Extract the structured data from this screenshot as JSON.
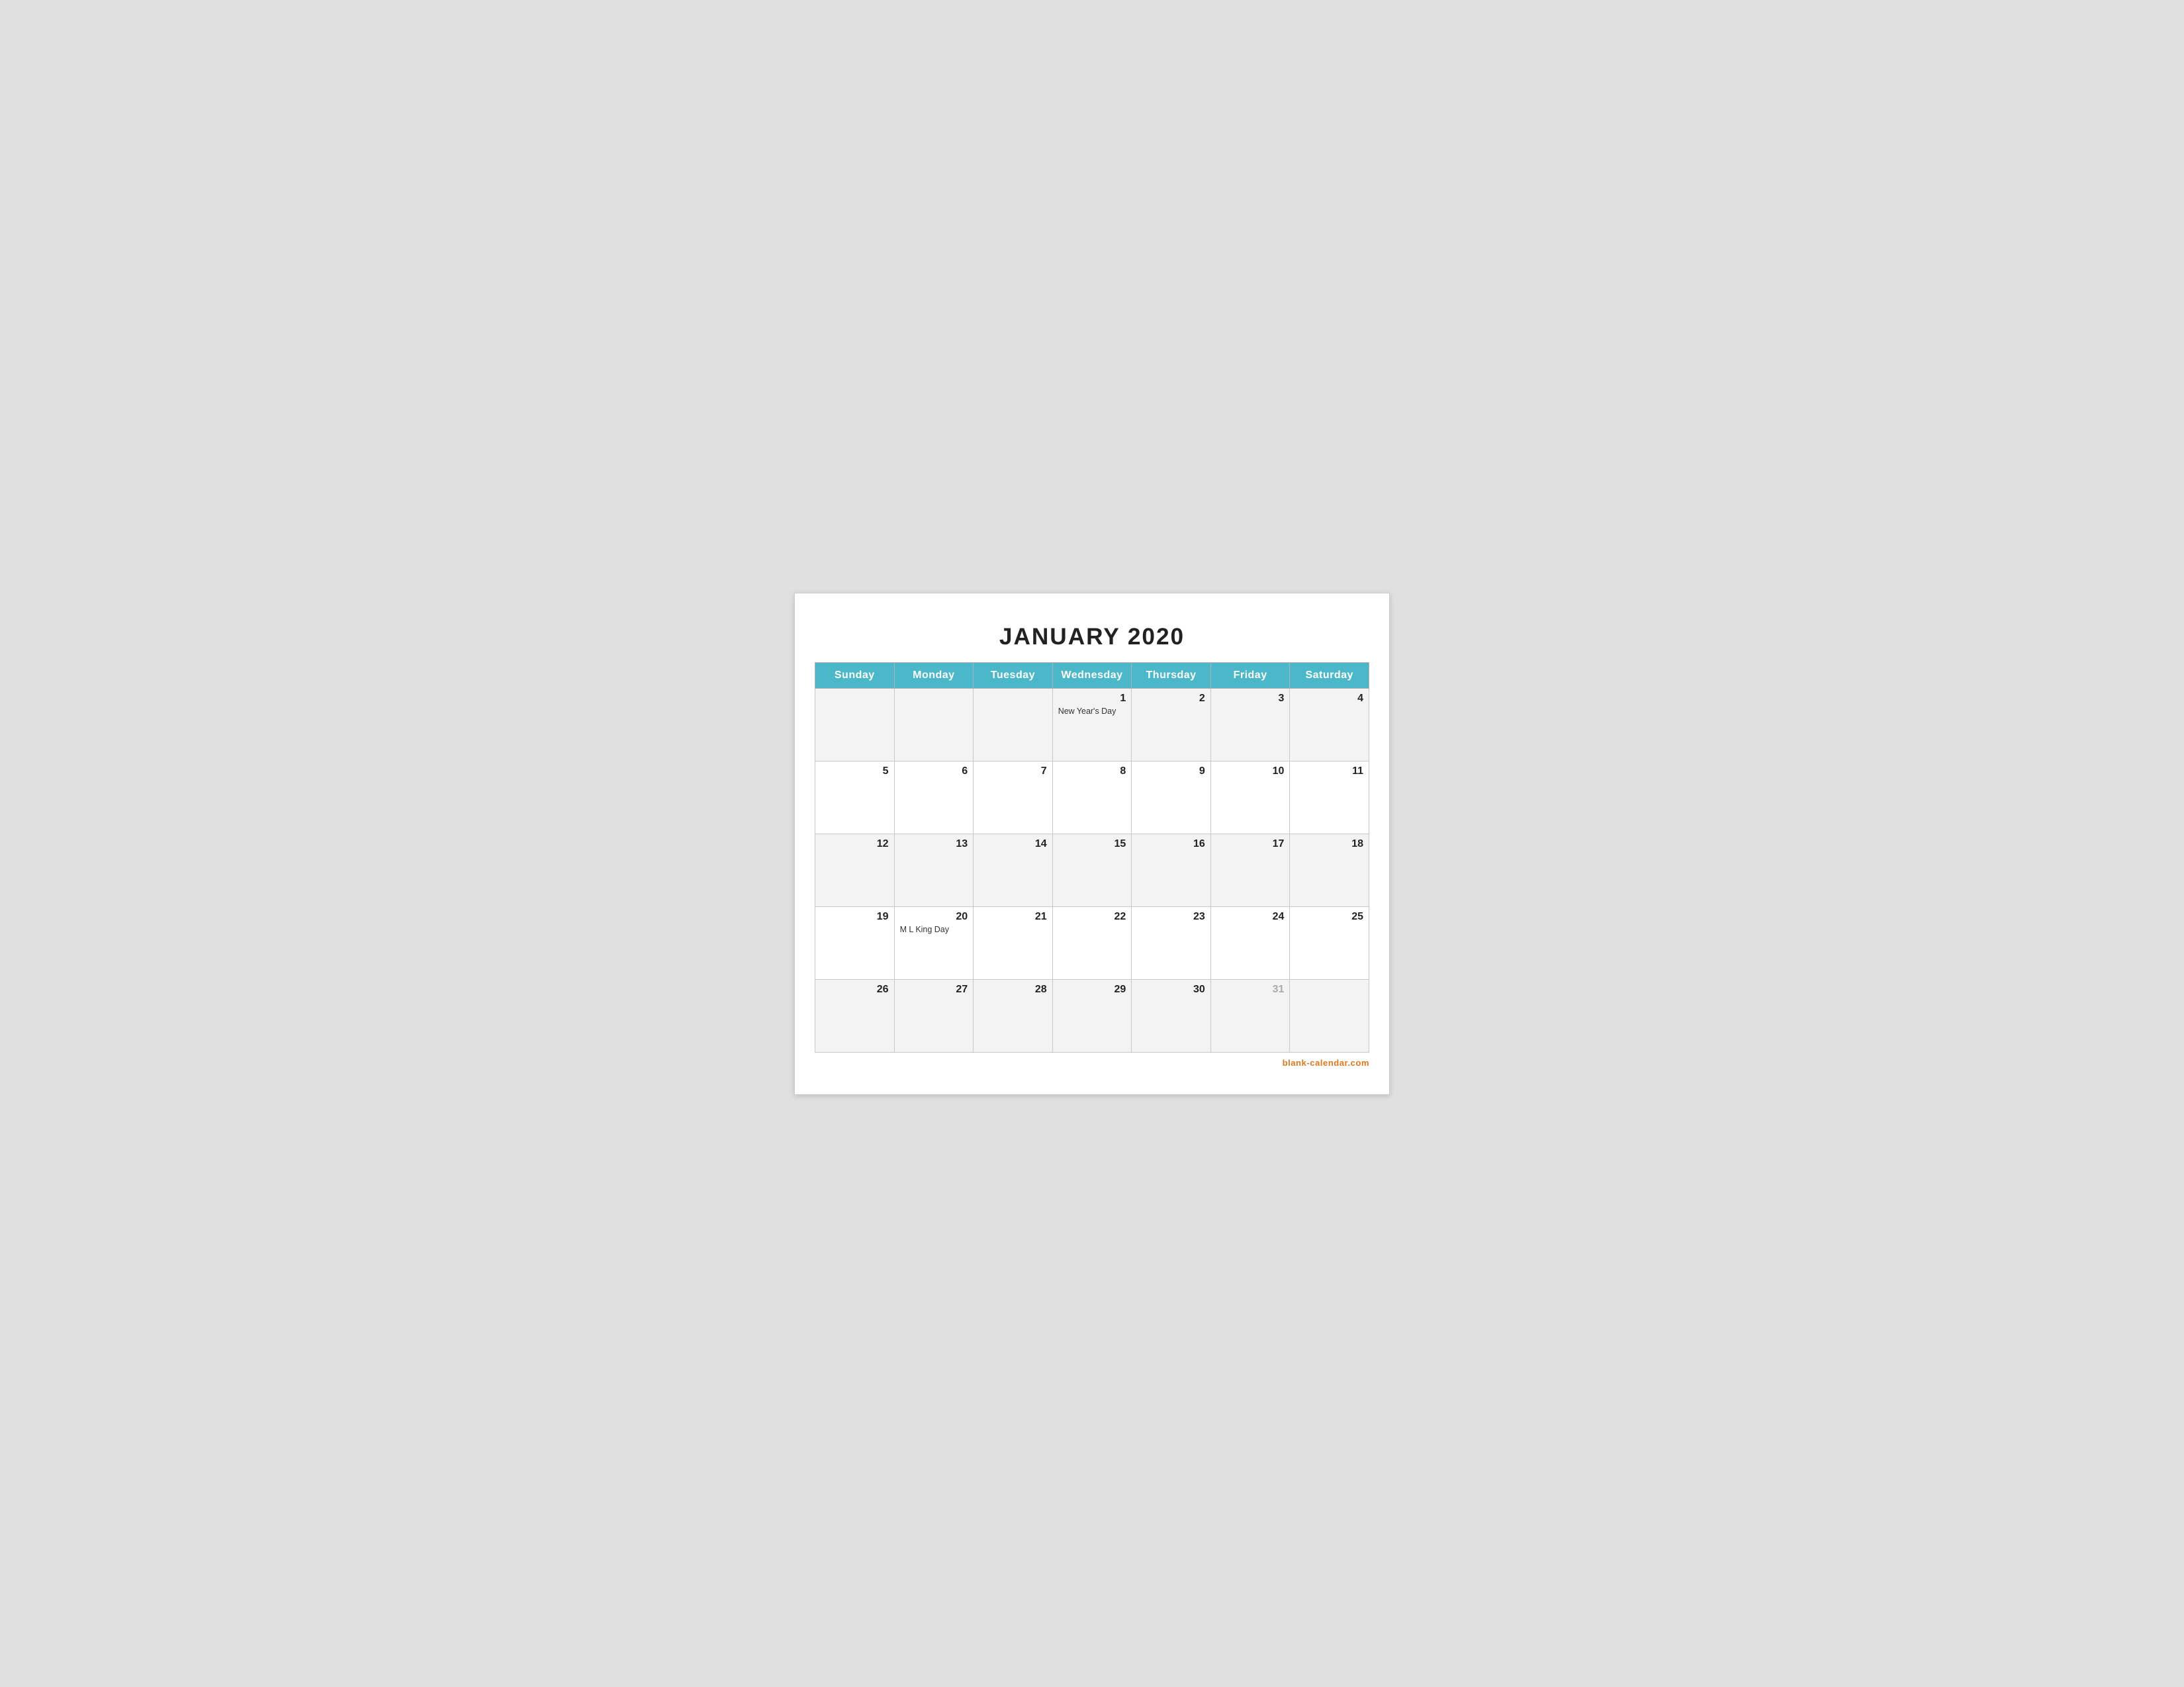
{
  "title": "JANUARY 2020",
  "header": {
    "days": [
      "Sunday",
      "Monday",
      "Tuesday",
      "Wednesday",
      "Thursday",
      "Friday",
      "Saturday"
    ]
  },
  "weeks": [
    [
      {
        "day": "",
        "empty": true
      },
      {
        "day": "",
        "empty": true
      },
      {
        "day": "",
        "empty": true
      },
      {
        "day": "1",
        "holiday": "New Year's Day"
      },
      {
        "day": "2"
      },
      {
        "day": "3"
      },
      {
        "day": "4"
      }
    ],
    [
      {
        "day": "5"
      },
      {
        "day": "6"
      },
      {
        "day": "7"
      },
      {
        "day": "8"
      },
      {
        "day": "9"
      },
      {
        "day": "10"
      },
      {
        "day": "11"
      }
    ],
    [
      {
        "day": "12"
      },
      {
        "day": "13"
      },
      {
        "day": "14"
      },
      {
        "day": "15"
      },
      {
        "day": "16"
      },
      {
        "day": "17"
      },
      {
        "day": "18"
      }
    ],
    [
      {
        "day": "19"
      },
      {
        "day": "20",
        "holiday": "M L King Day"
      },
      {
        "day": "21"
      },
      {
        "day": "22"
      },
      {
        "day": "23"
      },
      {
        "day": "24"
      },
      {
        "day": "25"
      }
    ],
    [
      {
        "day": "26"
      },
      {
        "day": "27"
      },
      {
        "day": "28"
      },
      {
        "day": "29"
      },
      {
        "day": "30"
      },
      {
        "day": "31",
        "muted": true
      },
      {
        "day": "",
        "empty": true
      }
    ]
  ],
  "footer": {
    "url": "blank-calendar.com"
  }
}
